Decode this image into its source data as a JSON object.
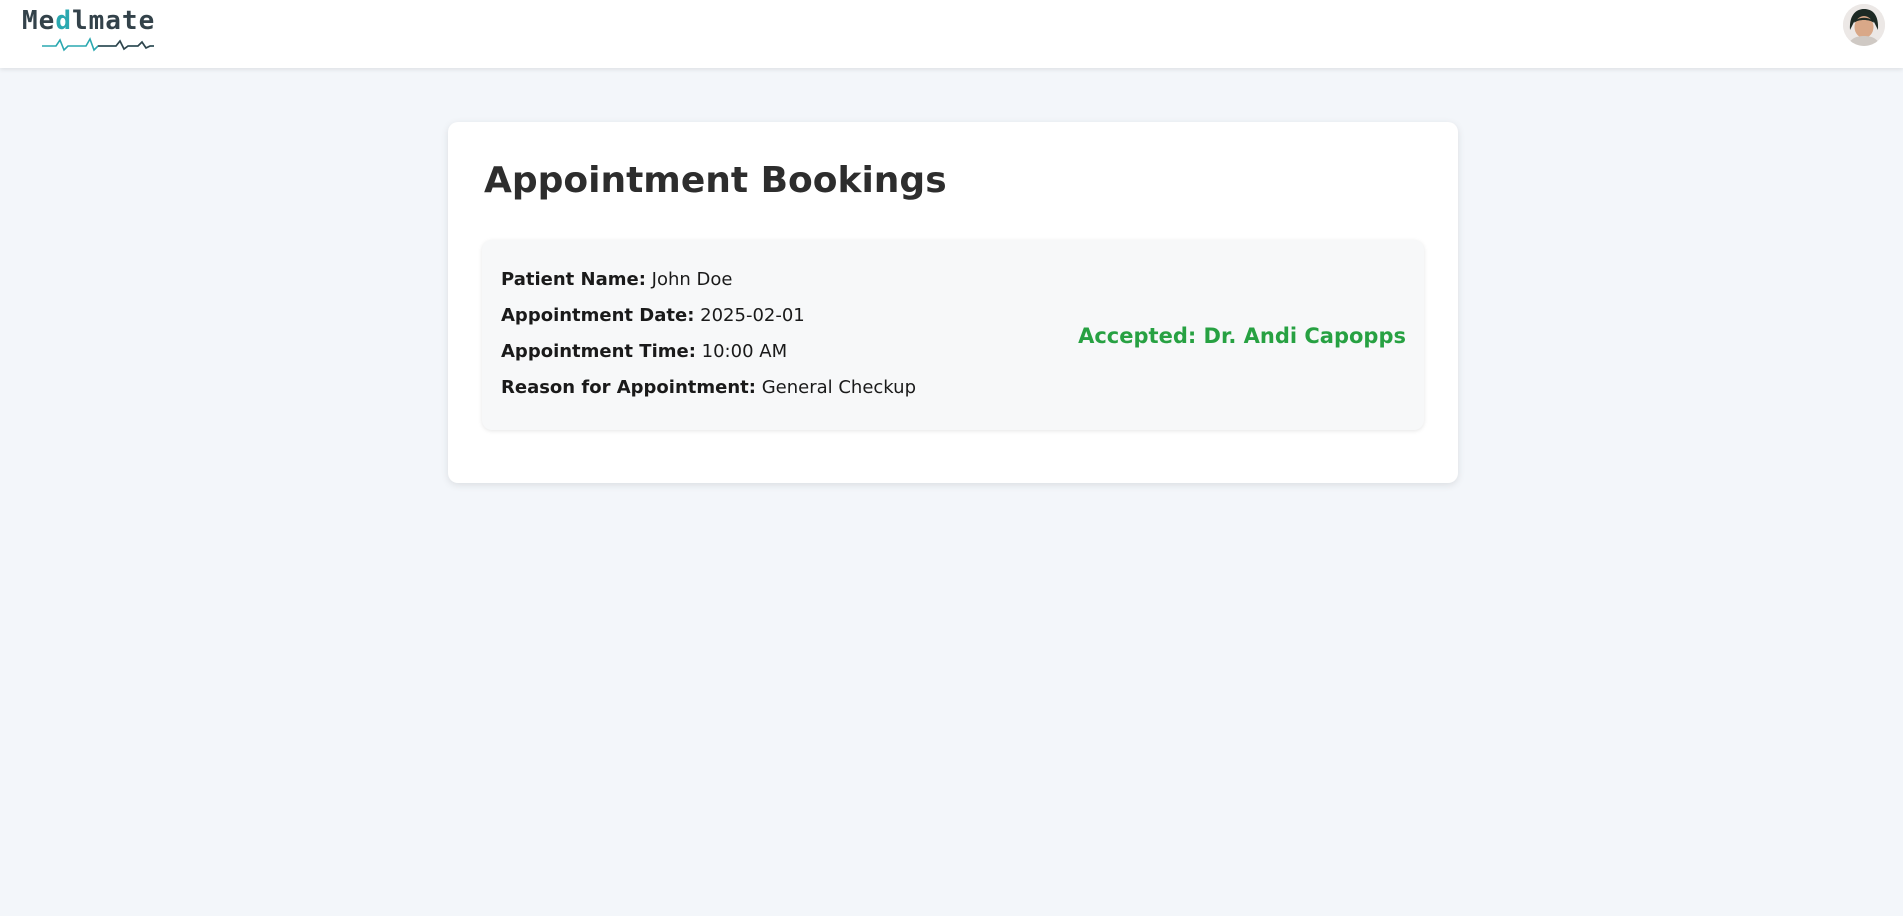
{
  "header": {
    "logo": {
      "prefix": "Me",
      "accent": "d",
      "suffix": "lmate",
      "brand_color": "#33424a",
      "accent_color": "#2aa8b0"
    },
    "avatar_icon": "user-avatar"
  },
  "main": {
    "title": "Appointment Bookings",
    "bookings": [
      {
        "fields": [
          {
            "label": "Patient Name:",
            "value": "John Doe"
          },
          {
            "label": "Appointment Date:",
            "value": "2025-02-01"
          },
          {
            "label": "Appointment Time:",
            "value": "10:00 AM"
          },
          {
            "label": "Reason for Appointment:",
            "value": "General Checkup"
          }
        ],
        "status": "Accepted: Dr. Andi Capopps",
        "status_color": "#27a142"
      }
    ]
  }
}
